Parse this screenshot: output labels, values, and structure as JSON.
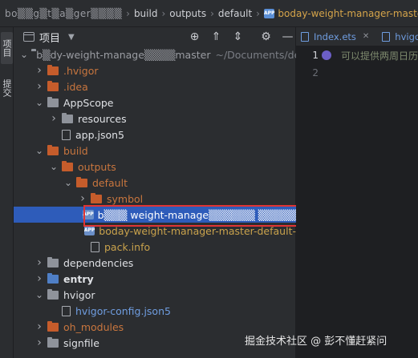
{
  "breadcrumb": {
    "items": [
      {
        "label": "bo▒▒g▒t▒a▒ger▒▒▒▒",
        "blur": true
      },
      {
        "label": "build"
      },
      {
        "label": "outputs"
      },
      {
        "label": "default"
      },
      {
        "label": "boday-weight-manager-maste",
        "app": true
      }
    ],
    "app_badge": "APP"
  },
  "left_strip": {
    "project_label": "项目",
    "commit_label": "提交"
  },
  "project_panel": {
    "title": "项目",
    "toolbar_icons": [
      "crosshair-icon",
      "expand-all-icon",
      "collapse-all-icon",
      "gear-icon",
      "minimize-icon"
    ]
  },
  "tree": [
    {
      "indent": 0,
      "arrow": "down",
      "icon": "folder-gray",
      "label": "b▒dy-weight-manage▒▒▒▒master",
      "label_style": "blur",
      "hint": "~/Documents/dev"
    },
    {
      "indent": 1,
      "arrow": "right",
      "icon": "folder-orange",
      "label": ".hvigor",
      "label_style": "orange"
    },
    {
      "indent": 1,
      "arrow": "right",
      "icon": "folder-orange",
      "label": ".idea",
      "label_style": "orange"
    },
    {
      "indent": 1,
      "arrow": "down",
      "icon": "folder-gray",
      "label": "AppScope",
      "label_style": ""
    },
    {
      "indent": 2,
      "arrow": "right",
      "icon": "folder-gray",
      "label": "resources",
      "label_style": ""
    },
    {
      "indent": 2,
      "arrow": "none",
      "icon": "file",
      "label": "app.json5",
      "label_style": ""
    },
    {
      "indent": 1,
      "arrow": "down",
      "icon": "folder-orange",
      "label": "build",
      "label_style": "orange"
    },
    {
      "indent": 2,
      "arrow": "down",
      "icon": "folder-orange",
      "label": "outputs",
      "label_style": "orange"
    },
    {
      "indent": 3,
      "arrow": "down",
      "icon": "folder-orange",
      "label": "default",
      "label_style": "orange"
    },
    {
      "indent": 4,
      "arrow": "right",
      "icon": "folder-orange",
      "label": "symbol",
      "label_style": "orange"
    },
    {
      "indent": 4,
      "arrow": "none",
      "icon": "app",
      "label": "b▒▒▒ weight-manage▒▒▒▒▒▒ ▒▒▒▒▒▒▒▒gned.app",
      "label_style": "white",
      "selected": true
    },
    {
      "indent": 4,
      "arrow": "none",
      "icon": "app",
      "label": "boday-weight-manager-master-default-",
      "label_style": "yellow"
    },
    {
      "indent": 4,
      "arrow": "none",
      "icon": "file",
      "label": "pack.info",
      "label_style": "yellow"
    },
    {
      "indent": 1,
      "arrow": "right",
      "icon": "folder-gray",
      "label": "dependencies",
      "label_style": ""
    },
    {
      "indent": 1,
      "arrow": "right",
      "icon": "folder-blue",
      "label": "entry",
      "label_style": "bold"
    },
    {
      "indent": 1,
      "arrow": "down",
      "icon": "folder-gray",
      "label": "hvigor",
      "label_style": ""
    },
    {
      "indent": 2,
      "arrow": "none",
      "icon": "file",
      "label": "hvigor-config.json5",
      "label_style": "blue"
    },
    {
      "indent": 1,
      "arrow": "right",
      "icon": "folder-orange",
      "label": "oh_modules",
      "label_style": "orange"
    },
    {
      "indent": 1,
      "arrow": "right",
      "icon": "folder-gray",
      "label": "signfile",
      "label_style": ""
    }
  ],
  "editor": {
    "tabs": [
      {
        "label": "Index.ets"
      },
      {
        "label": "hvigor"
      }
    ],
    "line_numbers": [
      "1",
      "2"
    ],
    "lines": [
      "可以提供两周日历",
      ""
    ]
  },
  "watermark": "掘金技术社区 @ 彭不懂赶紧问",
  "colors": {
    "background": "#2b2d30",
    "selection": "#2e5cba",
    "highlight_border": "#e03434",
    "excluded_folder": "#c55c2b"
  }
}
